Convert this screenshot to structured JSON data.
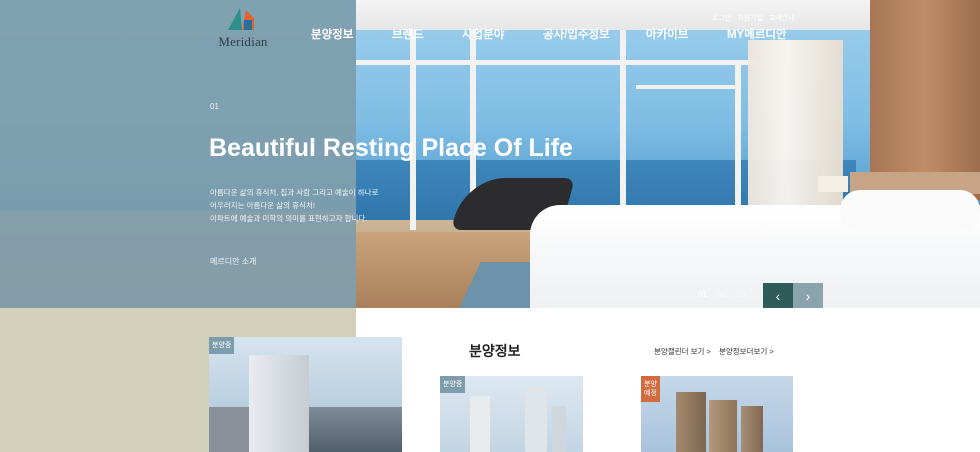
{
  "logo": {
    "text": "Meridian"
  },
  "top_links": [
    "로그인",
    "회원가입",
    "고객안내"
  ],
  "gnb": [
    "분양정보",
    "브랜드",
    "사업분야",
    "공사/입주정보",
    "아카이브",
    "MY메르디안"
  ],
  "hero": {
    "slide_number": "01",
    "headline": "Beautiful Resting Place Of Life",
    "description": [
      "아름다운 삶의 휴식처, 집과 사람 그리고 예술이 하나로",
      "어우러지는 아름다운 삶의 휴식처!",
      "아파트에 예술과 미학의 의미를 표현하고자 합니다."
    ],
    "more_link": "메르디안 소개",
    "pager": [
      "01",
      "02",
      "03"
    ],
    "active_page": "01",
    "prev_icon": "‹",
    "next_icon": "›"
  },
  "section": {
    "title": "분양정보",
    "links": [
      "분양캘린더 보기 >",
      "분양정보더보기 >"
    ],
    "cards": [
      {
        "badge": "분양중",
        "badge_color": "#7e9dac"
      },
      {
        "badge": "분양중",
        "badge_color": "#7e9dac"
      },
      {
        "badge": "분양\n예정",
        "badge_color": "#d46a3f"
      }
    ]
  },
  "colors": {
    "overlay": "#7e9dac",
    "beige": "#d2d0b8",
    "arrow_dark": "#2f5c58",
    "arrow_light": "#8ba3ad"
  }
}
